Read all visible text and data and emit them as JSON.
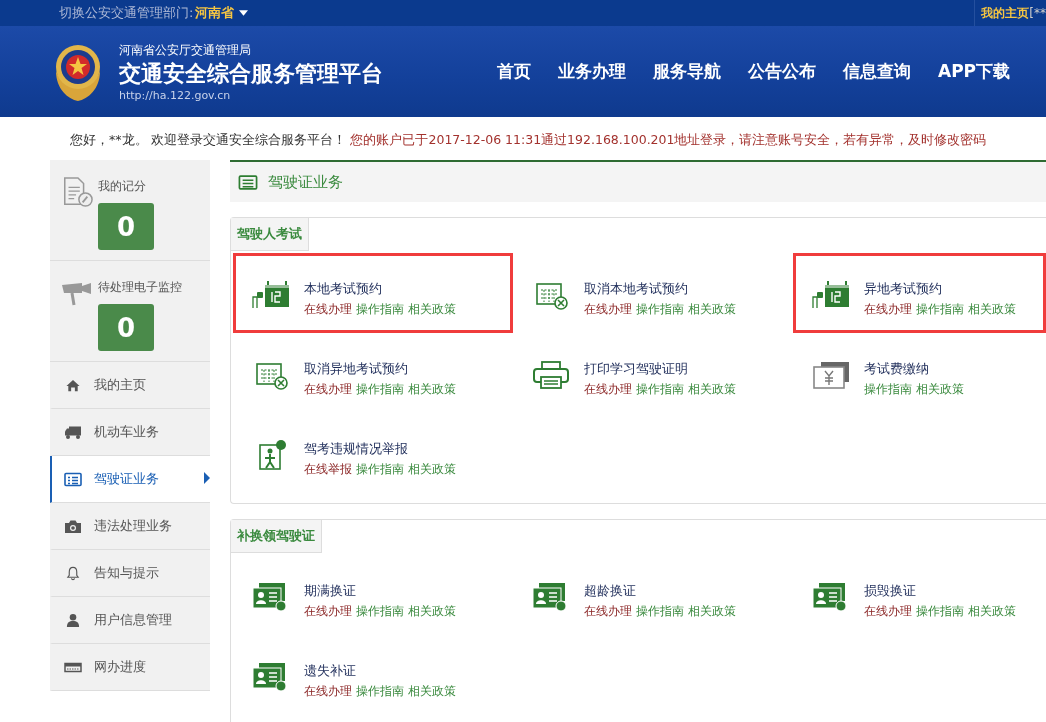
{
  "top_bar": {
    "switch_label": "切换公安交通管理部门:",
    "province": "河南省",
    "home_link": "我的主页",
    "user": "[**"
  },
  "header": {
    "org": "河南省公安厅交通管理局",
    "title": "交通安全综合服务管理平台",
    "url": "http://ha.122.gov.cn",
    "nav": [
      "首页",
      "业务办理",
      "服务导航",
      "公告公布",
      "信息查询",
      "APP下载"
    ]
  },
  "welcome": {
    "greeting": "您好，**龙。 欢迎登录交通安全综合服务平台！",
    "notice": "您的账户已于2017-12-06 11:31通过192.168.100.201地址登录，请注意账号安全，若有异常，及时修改密码"
  },
  "sidebar": {
    "stats": [
      {
        "label": "我的记分",
        "count": "0"
      },
      {
        "label": "待处理电子监控",
        "count": "0"
      }
    ],
    "items": [
      {
        "label": "我的主页",
        "selected": false
      },
      {
        "label": "机动车业务",
        "selected": false
      },
      {
        "label": "驾驶证业务",
        "selected": true
      },
      {
        "label": "违法处理业务",
        "selected": false
      },
      {
        "label": "告知与提示",
        "selected": false
      },
      {
        "label": "用户信息管理",
        "selected": false
      },
      {
        "label": "网办进度",
        "selected": false
      }
    ]
  },
  "panel": {
    "title": "驾驶证业务",
    "sections": [
      {
        "title": "驾驶人考试",
        "items": [
          {
            "title": "本地考试预约",
            "highlighted": true,
            "links": [
              {
                "text": "在线办理",
                "kind": "online"
              },
              {
                "text": "操作指南",
                "kind": "info"
              },
              {
                "text": "相关政策",
                "kind": "info"
              }
            ]
          },
          {
            "title": "取消本地考试预约",
            "highlighted": false,
            "links": [
              {
                "text": "在线办理",
                "kind": "online"
              },
              {
                "text": "操作指南",
                "kind": "info"
              },
              {
                "text": "相关政策",
                "kind": "info"
              }
            ]
          },
          {
            "title": "异地考试预约",
            "highlighted": true,
            "links": [
              {
                "text": "在线办理",
                "kind": "online"
              },
              {
                "text": "操作指南",
                "kind": "info"
              },
              {
                "text": "相关政策",
                "kind": "info"
              }
            ]
          },
          {
            "title": "取消异地考试预约",
            "highlighted": false,
            "links": [
              {
                "text": "在线办理",
                "kind": "online"
              },
              {
                "text": "操作指南",
                "kind": "info"
              },
              {
                "text": "相关政策",
                "kind": "info"
              }
            ]
          },
          {
            "title": "打印学习驾驶证明",
            "highlighted": false,
            "links": [
              {
                "text": "在线办理",
                "kind": "online"
              },
              {
                "text": "操作指南",
                "kind": "info"
              },
              {
                "text": "相关政策",
                "kind": "info"
              }
            ]
          },
          {
            "title": "考试费缴纳",
            "highlighted": false,
            "links": [
              {
                "text": "操作指南",
                "kind": "info"
              },
              {
                "text": "相关政策",
                "kind": "info"
              }
            ]
          },
          {
            "title": "驾考违规情况举报",
            "highlighted": false,
            "links": [
              {
                "text": "在线举报",
                "kind": "online"
              },
              {
                "text": "操作指南",
                "kind": "info"
              },
              {
                "text": "相关政策",
                "kind": "info"
              }
            ]
          }
        ]
      },
      {
        "title": "补换领驾驶证",
        "items": [
          {
            "title": "期满换证",
            "highlighted": false,
            "links": [
              {
                "text": "在线办理",
                "kind": "online"
              },
              {
                "text": "操作指南",
                "kind": "info"
              },
              {
                "text": "相关政策",
                "kind": "info"
              }
            ]
          },
          {
            "title": "超龄换证",
            "highlighted": false,
            "links": [
              {
                "text": "在线办理",
                "kind": "online"
              },
              {
                "text": "操作指南",
                "kind": "info"
              },
              {
                "text": "相关政策",
                "kind": "info"
              }
            ]
          },
          {
            "title": "损毁换证",
            "highlighted": false,
            "links": [
              {
                "text": "在线办理",
                "kind": "online"
              },
              {
                "text": "操作指南",
                "kind": "info"
              },
              {
                "text": "相关政策",
                "kind": "info"
              }
            ]
          },
          {
            "title": "遗失补证",
            "highlighted": false,
            "links": [
              {
                "text": "在线办理",
                "kind": "online"
              },
              {
                "text": "操作指南",
                "kind": "info"
              },
              {
                "text": "相关政策",
                "kind": "info"
              }
            ]
          }
        ]
      }
    ]
  }
}
